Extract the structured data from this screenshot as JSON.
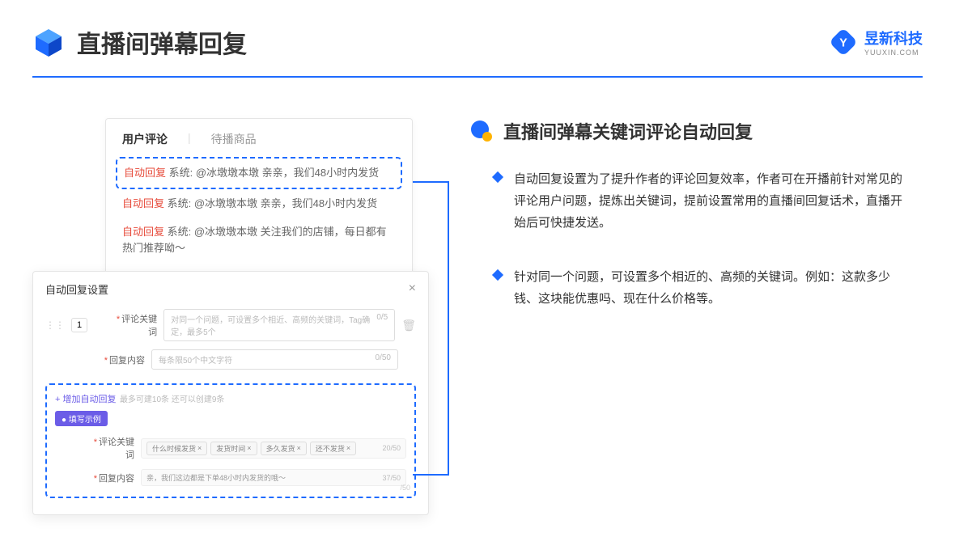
{
  "header": {
    "title": "直播间弹幕回复",
    "brand": "昱新科技",
    "brand_sub": "YUUXIN.COM"
  },
  "card1": {
    "tab_active": "用户评论",
    "tab_inactive": "待播商品",
    "highlight_prefix": "自动回复",
    "highlight_text": " 系统: @冰墩墩本墩 亲亲，我们48小时内发货",
    "row2_prefix": "自动回复",
    "row2_text": " 系统: @冰墩墩本墩 亲亲，我们48小时内发货",
    "row3_prefix": "自动回复",
    "row3_text": " 系统: @冰墩墩本墩 关注我们的店铺，每日都有热门推荐呦～"
  },
  "card2": {
    "title": "自动回复设置",
    "num": "1",
    "kw_label": "评论关键词",
    "kw_placeholder": "对同一个问题，可设置多个相近、高频的关键词，Tag确定，最多5个",
    "kw_count": "0/5",
    "content_label": "回复内容",
    "content_placeholder": "每条限50个中文字符",
    "content_count": "0/50",
    "add_link": "+ 增加自动回复",
    "add_hint": "最多可建10条 还可以创建9条",
    "example_tag": "● 填写示例",
    "ex_kw_label": "评论关键词",
    "tags": [
      "什么时候发货",
      "发货时间",
      "多久发货",
      "还不发货"
    ],
    "ex_kw_count": "20/50",
    "ex_content_label": "回复内容",
    "ex_content_val": "亲，我们这边都是下单48小时内发货的哦～",
    "ex_content_count": "37/50",
    "ghost_count": "/50"
  },
  "right": {
    "subtitle": "直播间弹幕关键词评论自动回复",
    "bullet1": "自动回复设置为了提升作者的评论回复效率，作者可在开播前针对常见的评论用户问题，提炼出关键词，提前设置常用的直播间回复话术，直播开始后可快捷发送。",
    "bullet2": "针对同一个问题，可设置多个相近的、高频的关键词。例如：这款多少钱、这块能优惠吗、现在什么价格等。"
  }
}
